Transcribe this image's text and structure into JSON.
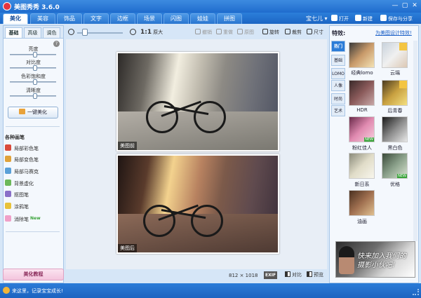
{
  "app": {
    "title": "美图秀秀 3.6.0"
  },
  "user": {
    "name": "宝七儿 ▾"
  },
  "main_tabs": [
    "美化",
    "美容",
    "饰品",
    "文字",
    "边框",
    "场景",
    "闪图",
    "娃娃",
    "拼图"
  ],
  "top_actions": {
    "open": "打开",
    "new": "新建",
    "save_share": "保存与分享"
  },
  "left_panel": {
    "subtabs": [
      "基础",
      "高级",
      "调色"
    ],
    "adjustments": [
      {
        "label": "亮度",
        "level": 0.55
      },
      {
        "label": "对比度",
        "level": 0.55
      },
      {
        "label": "色彩饱和度",
        "level": 0.55
      },
      {
        "label": "清晰度",
        "level": 0.55
      }
    ],
    "one_click": "一键美化",
    "brush_heading": "各种画笔",
    "brushes": [
      {
        "label": "局部彩色笔",
        "color": "#d94a3a"
      },
      {
        "label": "局部变色笔",
        "color": "#e0a23a"
      },
      {
        "label": "局部马赛克",
        "color": "#5aa0d8"
      },
      {
        "label": "背景虚化",
        "color": "#6cb85a"
      },
      {
        "label": "抠图笔",
        "color": "#8a70c8"
      },
      {
        "label": "涂鸦笔",
        "color": "#e8c23a"
      },
      {
        "label": "消除笔",
        "color": "#f0a0c8",
        "badge": "New"
      }
    ],
    "tutorial": "美化教程"
  },
  "toolbar": {
    "ratio": "1:1",
    "original": "原大",
    "undo": "撤销",
    "redo": "重做",
    "original_img": "原图",
    "rotate": "旋转",
    "crop": "裁剪",
    "size": "尺寸",
    "zoom_level": 0.1
  },
  "canvas": {
    "before_label": "美图前",
    "after_label": "美图后",
    "image_size": "812 × 1018",
    "exif": "EXIF",
    "compare": "对比",
    "preview": "预览"
  },
  "right_panel": {
    "title": "特效:",
    "link": "为美图设计特效!",
    "categories": [
      "热门",
      "基础",
      "LOMO",
      "人像",
      "时尚",
      "艺术"
    ],
    "effects": [
      {
        "label": "经典lomo",
        "colors": [
          "#3a3a3a",
          "#c89a6a",
          "#f4e2b4"
        ]
      },
      {
        "label": "云端",
        "colors": [
          "#c8d2dc",
          "#f0f0f0",
          "#dcc8b4"
        ],
        "badge": true
      },
      {
        "label": "HDR",
        "colors": [
          "#3a2a2a",
          "#8a5a5a",
          "#c8a8a8"
        ]
      },
      {
        "label": "后青春",
        "colors": [
          "#4a3a20",
          "#c8a040",
          "#f4e080"
        ],
        "badge": true
      },
      {
        "label": "粉红佳人",
        "colors": [
          "#6a2a4a",
          "#e08ab0",
          "#f8d0e0"
        ],
        "isNew": true
      },
      {
        "label": "黑白色",
        "colors": [
          "#1a1a1a",
          "#8a8a8a",
          "#e8e8e8"
        ]
      },
      {
        "label": "新日系",
        "colors": [
          "#8a8a7a",
          "#e0dcc8",
          "#f8f6ec"
        ]
      },
      {
        "label": "优格",
        "colors": [
          "#3a4a3a",
          "#8aa08a",
          "#d8e4d0"
        ],
        "isNew": true
      },
      {
        "label": "油画",
        "colors": [
          "#4a3020",
          "#a07050",
          "#e0c090"
        ]
      }
    ],
    "banner": "快来加入我们的\n摄影小伙吧!"
  },
  "status": {
    "text": "来这里，记录宝宝成长!"
  }
}
